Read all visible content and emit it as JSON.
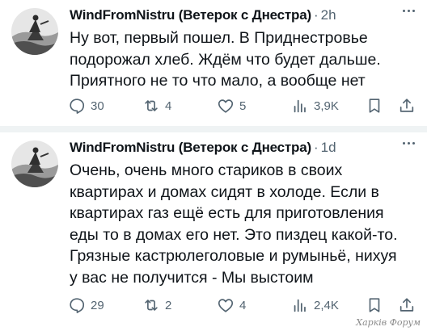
{
  "tweets": [
    {
      "display_name": "WindFromNistru (Ветерок с Днестра)",
      "separator": "·",
      "time": "2h",
      "text_lines": [
        "Ну вот, первый пошел. В Приднестровье",
        "подорожал хлеб. Ждём что будет дальше.",
        "Приятного не то что мало, а вообще нет"
      ],
      "replies": "30",
      "reposts": "4",
      "likes": "5",
      "views": "3,9K"
    },
    {
      "display_name": "WindFromNistru (Ветерок с Днестра)",
      "separator": "·",
      "time": "1d",
      "text_lines": [
        "Очень, очень много стариков в своих",
        "квартирах и домах сидят в холоде. Если в",
        "квартирах газ ещё есть для приготовления",
        "еды то в домах его нет. Это пиздец какой-то.",
        "Грязные кастрюлеголовые и румыньё, нихуя",
        "у вас не получится - Мы выстоим"
      ],
      "replies": "29",
      "reposts": "2",
      "likes": "4",
      "views": "2,4K"
    }
  ],
  "icons": {
    "reply": "reply-icon",
    "repost": "repost-icon",
    "like": "like-icon",
    "views": "views-icon",
    "bookmark": "bookmark-icon",
    "share": "share-icon",
    "more": "more-options-icon"
  },
  "colors": {
    "text": "#0f1419",
    "secondary": "#536471",
    "separator": "#eff3f4"
  },
  "watermark": "Харків Форум"
}
